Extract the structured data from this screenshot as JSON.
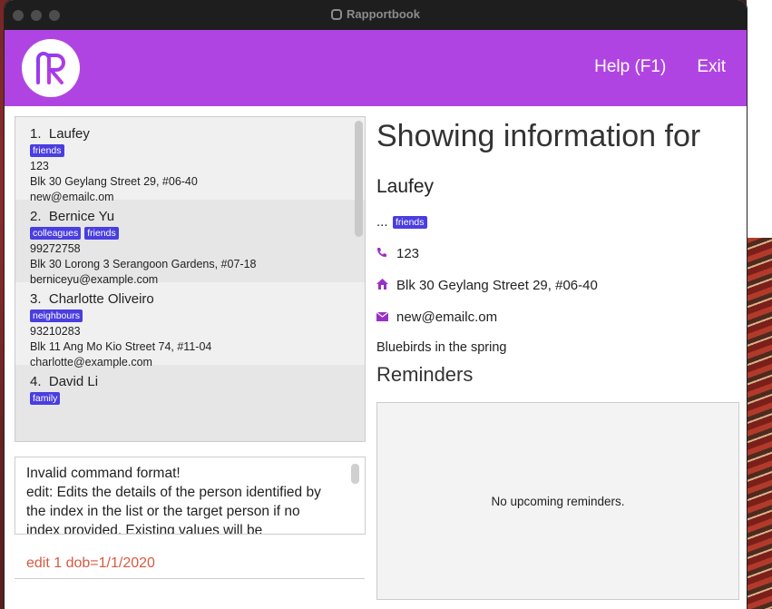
{
  "window": {
    "title": "Rapportbook"
  },
  "menu": {
    "help": "Help (F1)",
    "exit": "Exit"
  },
  "persons": [
    {
      "index": "1.",
      "name": "Laufey",
      "tags": [
        "friends"
      ],
      "phone": "123",
      "address": "Blk 30 Geylang Street 29, #06-40",
      "email": "new@emailc.om"
    },
    {
      "index": "2.",
      "name": "Bernice Yu",
      "tags": [
        "colleagues",
        "friends"
      ],
      "phone": "99272758",
      "address": "Blk 30 Lorong 3 Serangoon Gardens, #07-18",
      "email": "berniceyu@example.com"
    },
    {
      "index": "3.",
      "name": "Charlotte Oliveiro",
      "tags": [
        "neighbours"
      ],
      "phone": "93210283",
      "address": "Blk 11 Ang Mo Kio Street 74, #11-04",
      "email": "charlotte@example.com"
    },
    {
      "index": "4.",
      "name": "David Li",
      "tags": [
        "family"
      ],
      "phone": "",
      "address": "",
      "email": ""
    }
  ],
  "result": {
    "line1": "Invalid command format!",
    "line2": "edit: Edits the details of the person identified by the index in the list or the target person if no index provided. Existing values will be"
  },
  "command_input": {
    "value": "edit 1 dob=1/1/2020"
  },
  "details": {
    "heading": "Showing information for",
    "name": "Laufey",
    "dots": "...",
    "tag": "friends",
    "phone": "123",
    "address": "Blk 30 Geylang Street 29, #06-40",
    "email": "new@emailc.om",
    "notes": "Bluebirds in the spring",
    "reminders_heading": "Reminders",
    "reminders_empty": "No upcoming reminders."
  },
  "colors": {
    "accent": "#b044e3",
    "tag": "#4a3ee0",
    "command": "#d9593f",
    "icon": "#9a2fc5"
  },
  "icons": [
    "phone-icon",
    "home-icon",
    "email-icon",
    "app-logo-icon"
  ]
}
